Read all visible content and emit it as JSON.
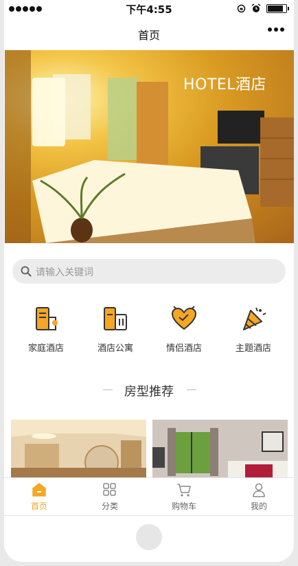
{
  "status": {
    "time": "下午4:55"
  },
  "nav": {
    "title": "首页"
  },
  "banner": {
    "title": "HOTEL酒店"
  },
  "search": {
    "placeholder": "请输入关键词"
  },
  "categories": [
    {
      "label": "家庭酒店",
      "icon": "building-icon"
    },
    {
      "label": "酒店公寓",
      "icon": "apartment-icon"
    },
    {
      "label": "情侣酒店",
      "icon": "heart-icon"
    },
    {
      "label": "主题酒店",
      "icon": "party-icon"
    }
  ],
  "section": {
    "title": "房型推荐"
  },
  "tabs": [
    {
      "label": "首页",
      "icon": "home-icon",
      "active": true
    },
    {
      "label": "分类",
      "icon": "grid-icon"
    },
    {
      "label": "购物车",
      "icon": "cart-icon"
    },
    {
      "label": "我的",
      "icon": "user-icon"
    }
  ],
  "colors": {
    "accent": "#f5a623",
    "icon_stroke": "#333333"
  }
}
